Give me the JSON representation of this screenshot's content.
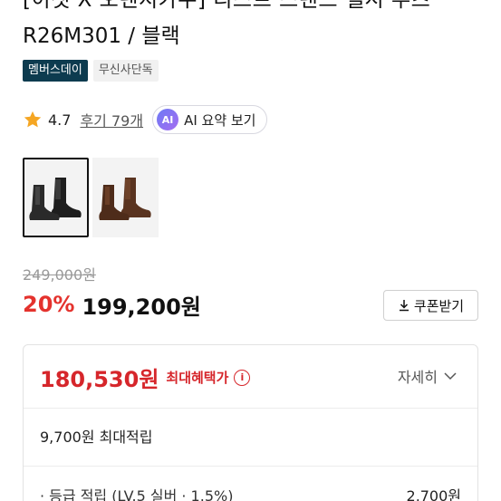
{
  "product": {
    "title_partial": "[이젯 X 오렌지카우] 리스트 스탠드 첼시 부츠",
    "title_line": "R26M301 / 블랙",
    "badges": [
      "멤버스데이",
      "무신사단독"
    ]
  },
  "reviews": {
    "rating": "4.7",
    "count_label": "후기 79개",
    "ai_icon_text": "AI",
    "ai_summary_label": "AI 요약 보기",
    "star_color": "#f5a623"
  },
  "thumbnails": [
    {
      "label": "블랙",
      "color": "#222222"
    },
    {
      "label": "브라운",
      "color": "#5a3420"
    }
  ],
  "pricing": {
    "original_price": "249,000원",
    "discount": "20%",
    "price": "199,200원",
    "coupon_label": "쿠폰받기",
    "accent_color": "#e4322d"
  },
  "benefits": {
    "max_price": "180,530원",
    "max_label": "최대혜택가",
    "info_icon": "i",
    "detail_label": "자세히",
    "points_line": "9,700원 최대적립",
    "grade_label": "· 등급 적립 (LV.5 실버 · 1.5%)",
    "grade_value": "2,700원"
  }
}
